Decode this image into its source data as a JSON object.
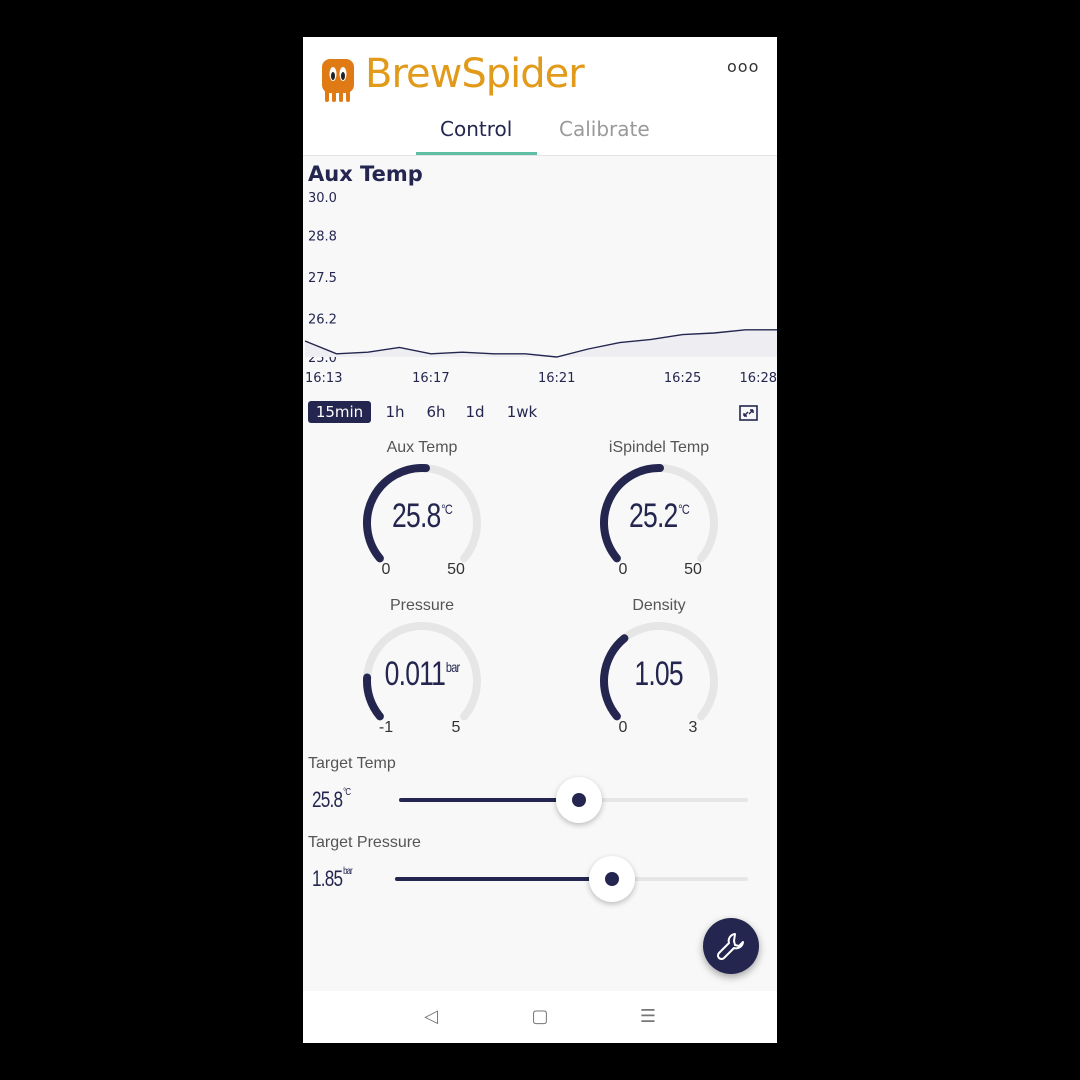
{
  "app": {
    "name": "BrewSpider",
    "more_label": "ooo"
  },
  "tabs": [
    {
      "label": "Control",
      "active": true
    },
    {
      "label": "Calibrate",
      "active": false
    }
  ],
  "chart": {
    "title": "Aux Temp",
    "range_buttons": [
      "15min",
      "1h",
      "6h",
      "1d",
      "1wk"
    ],
    "selected_range": "15min"
  },
  "chart_data": {
    "type": "area",
    "title": "Aux Temp",
    "x_ticks": [
      "16:13",
      "16:17",
      "16:21",
      "16:25",
      "16:28"
    ],
    "y_ticks": [
      "30.0",
      "28.8",
      "27.5",
      "26.2",
      "25.0"
    ],
    "ylim": [
      25.0,
      30.0
    ],
    "series": [
      {
        "x": [
          "16:13",
          "16:14",
          "16:15",
          "16:16",
          "16:17",
          "16:18",
          "16:19",
          "16:20",
          "16:21",
          "16:22",
          "16:23",
          "16:24",
          "16:25",
          "16:26",
          "16:27",
          "16:28"
        ],
        "values": [
          25.5,
          25.1,
          25.15,
          25.3,
          25.1,
          25.15,
          25.1,
          25.1,
          25.0,
          25.25,
          25.45,
          25.55,
          25.7,
          25.75,
          25.85,
          25.85
        ]
      }
    ],
    "grid": false
  },
  "gauges": [
    {
      "label": "Aux Temp",
      "value": "25.8",
      "unit": "°C",
      "min": "0",
      "max": "50",
      "fraction": 0.516
    },
    {
      "label": "iSpindel Temp",
      "value": "25.2",
      "unit": "°C",
      "min": "0",
      "max": "50",
      "fraction": 0.504
    },
    {
      "label": "Pressure",
      "value": "0.011",
      "unit": "bar",
      "min": "-1",
      "max": "5",
      "fraction": 0.168
    },
    {
      "label": "Density",
      "value": "1.05",
      "unit": "",
      "min": "0",
      "max": "3",
      "fraction": 0.35
    }
  ],
  "sliders": {
    "target_temp": {
      "label": "Target Temp",
      "value": "25.8",
      "unit": "°C",
      "fraction": 0.516
    },
    "target_pressure": {
      "label": "Target Pressure",
      "value": "1.85",
      "unit": "bar",
      "fraction": 0.615
    }
  },
  "fab": {
    "icon": "wrench-icon"
  },
  "navbar": {
    "back": "◁",
    "home": "▢",
    "menu": "☰"
  },
  "colors": {
    "primary": "#24264f",
    "brand": "#e19a1a",
    "accent": "#5fbfa5",
    "track": "#e6e6e6"
  }
}
